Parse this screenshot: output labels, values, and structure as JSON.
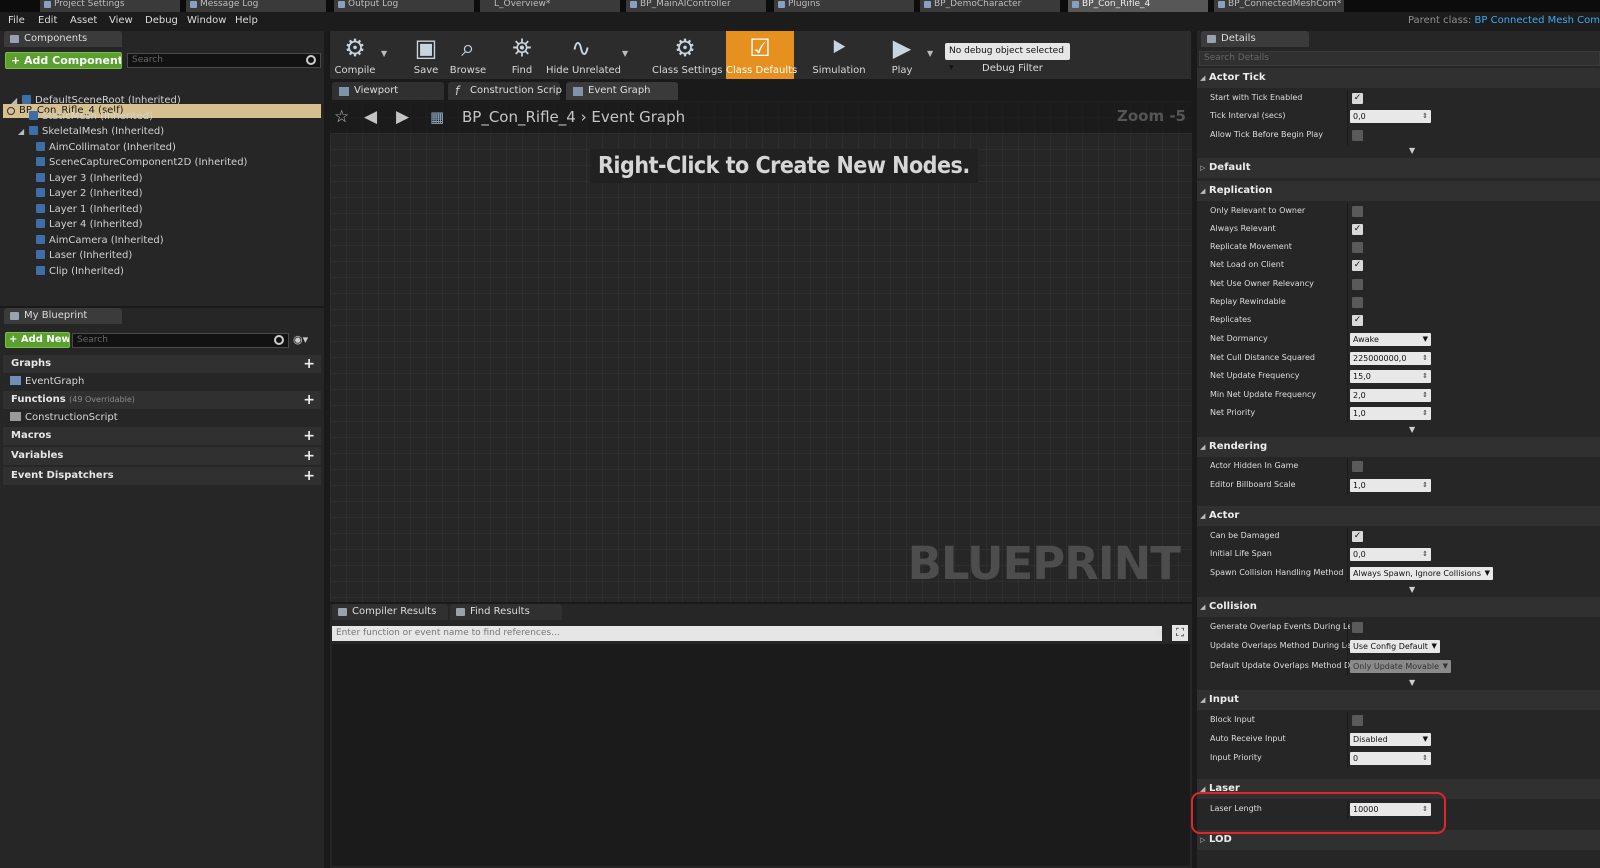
{
  "doc_tabs": [
    {
      "label": "Project Settings"
    },
    {
      "label": "Message Log"
    },
    {
      "label": "Output Log"
    },
    {
      "label": "L_Overview*"
    },
    {
      "label": "BP_MainAIController"
    },
    {
      "label": "Plugins"
    },
    {
      "label": "BP_DemoCharacter"
    },
    {
      "label": "BP_Con_Rifle_4"
    },
    {
      "label": "BP_ConnectedMeshCom*"
    }
  ],
  "menu": [
    "File",
    "Edit",
    "Asset",
    "View",
    "Debug",
    "Window",
    "Help"
  ],
  "parent_class": {
    "label": "Parent class:",
    "value": "BP Connected Mesh Com"
  },
  "components": {
    "tab": "Components",
    "add_button": "+ Add Component",
    "search_placeholder": "Search",
    "self_row": "BP_Con_Rifle_4 (self)",
    "tree": [
      "DefaultSceneRoot (Inherited)",
      "StaticMesh (Inherited)",
      "SkeletalMesh (Inherited)",
      "AimCollimator (Inherited)",
      "SceneCaptureComponent2D (Inherited)",
      "Layer 3 (Inherited)",
      "Layer 2 (Inherited)",
      "Layer 1 (Inherited)",
      "Layer 4 (Inherited)",
      "AimCamera (Inherited)",
      "Laser (Inherited)",
      "Clip (Inherited)"
    ]
  },
  "my_blueprint": {
    "tab": "My Blueprint",
    "add_button": "+ Add New",
    "search_placeholder": "Search",
    "graphs": "Graphs",
    "event_graph": "EventGraph",
    "functions": "Functions",
    "functions_sub": "(49 Overridable)",
    "construction_script": "ConstructionScript",
    "macros": "Macros",
    "variables": "Variables",
    "event_dispatchers": "Event Dispatchers"
  },
  "toolbar": [
    {
      "label": "Compile",
      "icon": "compile-icon"
    },
    {
      "label": "Save",
      "icon": "save-icon"
    },
    {
      "label": "Browse",
      "icon": "browse-icon"
    },
    {
      "label": "Find",
      "icon": "find-icon"
    },
    {
      "label": "Hide Unrelated",
      "icon": "hide-unrelated-icon"
    },
    {
      "label": "Class Settings",
      "icon": "class-settings-icon"
    },
    {
      "label": "Class Defaults",
      "icon": "class-defaults-icon"
    },
    {
      "label": "Simulation",
      "icon": "simulation-icon"
    },
    {
      "label": "Play",
      "icon": "play-icon"
    }
  ],
  "debug_filter": {
    "value": "No debug object selected",
    "label": "Debug Filter"
  },
  "editor_tabs": [
    "Viewport",
    "Construction Scrip",
    "Event Graph"
  ],
  "graph": {
    "crumb_root": "BP_Con_Rifle_4",
    "crumb_leaf": "Event Graph",
    "zoom": "Zoom -5",
    "hint": "Right-Click to Create New Nodes.",
    "watermark": "BLUEPRINT"
  },
  "lower_tabs": [
    "Compiler Results",
    "Find Results"
  ],
  "find_placeholder": "Enter function or event name to find references...",
  "details": {
    "tab": "Details",
    "search_placeholder": "Search Details",
    "actor_tick": {
      "title": "Actor Tick",
      "start_with_tick": "Start with Tick Enabled",
      "tick_interval": "Tick Interval (secs)",
      "tick_interval_value": "0,0",
      "allow_tick": "Allow Tick Before Begin Play"
    },
    "default_title": "Default",
    "replication": {
      "title": "Replication",
      "only_relevant": "Only Relevant to Owner",
      "always_relevant": "Always Relevant",
      "replicate_movement": "Replicate Movement",
      "net_load": "Net Load on Client",
      "net_use_owner": "Net Use Owner Relevancy",
      "replay_rewindable": "Replay Rewindable",
      "replicates": "Replicates",
      "net_dormancy": "Net Dormancy",
      "net_dormancy_value": "Awake",
      "net_cull": "Net Cull Distance Squared",
      "net_cull_value": "225000000,0",
      "net_update": "Net Update Frequency",
      "net_update_value": "15,0",
      "min_net_update": "Min Net Update Frequency",
      "min_net_update_value": "2,0",
      "net_priority": "Net Priority",
      "net_priority_value": "1,0"
    },
    "rendering": {
      "title": "Rendering",
      "hidden": "Actor Hidden In Game",
      "billboard": "Editor Billboard Scale",
      "billboard_value": "1,0"
    },
    "actor": {
      "title": "Actor",
      "can_damage": "Can be Damaged",
      "life_span": "Initial Life Span",
      "life_span_value": "0,0",
      "spawn": "Spawn Collision Handling Method",
      "spawn_value": "Always Spawn, Ignore Collisions"
    },
    "collision": {
      "title": "Collision",
      "gen_overlap": "Generate Overlap Events During Lev",
      "update_overlap": "Update Overlaps Method During Lev",
      "update_overlap_value": "Use Config Default",
      "default_update": "Default Update Overlaps Method Du",
      "default_update_value": "Only Update Movable"
    },
    "input": {
      "title": "Input",
      "block": "Block Input",
      "auto_receive": "Auto Receive Input",
      "auto_receive_value": "Disabled",
      "priority": "Input Priority",
      "priority_value": "0"
    },
    "laser": {
      "title": "Laser",
      "length": "Laser Length",
      "length_value": "10000"
    },
    "lod_title": "LOD"
  },
  "colors": {
    "accent": "#e6911f",
    "add_green": "#5a9f2f",
    "link_blue": "#3fa9f5",
    "highlight_red": "#e0262b"
  }
}
